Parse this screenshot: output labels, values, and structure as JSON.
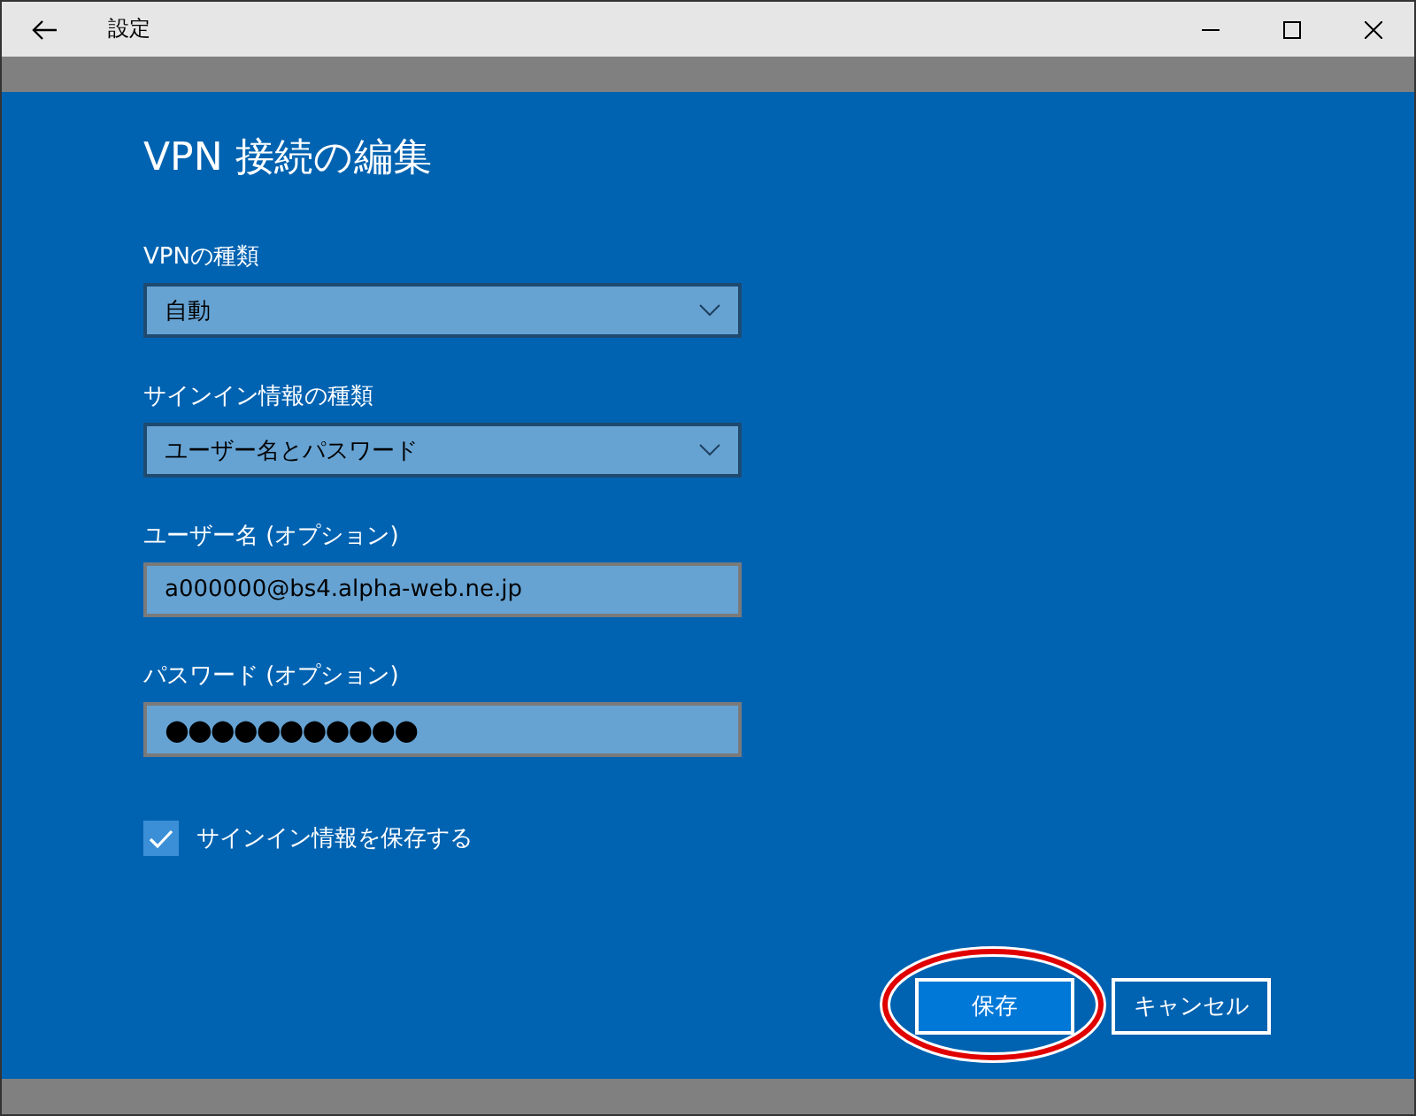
{
  "window": {
    "title": "設定"
  },
  "dialog": {
    "title": "VPN 接続の編集",
    "fields": [
      {
        "kind": "dropdown",
        "label": "VPNの種類",
        "value": "自動"
      },
      {
        "kind": "dropdown",
        "label": "サインイン情報の種類",
        "value": "ユーザー名とパスワード"
      },
      {
        "kind": "text",
        "label": "ユーザー名 (オプション)",
        "value": "a000000@bs4.alpha-web.ne.jp"
      },
      {
        "kind": "password",
        "label": "パスワード (オプション)",
        "value": "●●●●●●●●●●●"
      }
    ],
    "remember": {
      "label": "サインイン情報を保存する",
      "checked": true
    },
    "buttons": [
      {
        "label": "保存",
        "kind": "primary",
        "highlighted": true
      },
      {
        "label": "キャンセル",
        "kind": "secondary",
        "highlighted": false
      }
    ]
  }
}
